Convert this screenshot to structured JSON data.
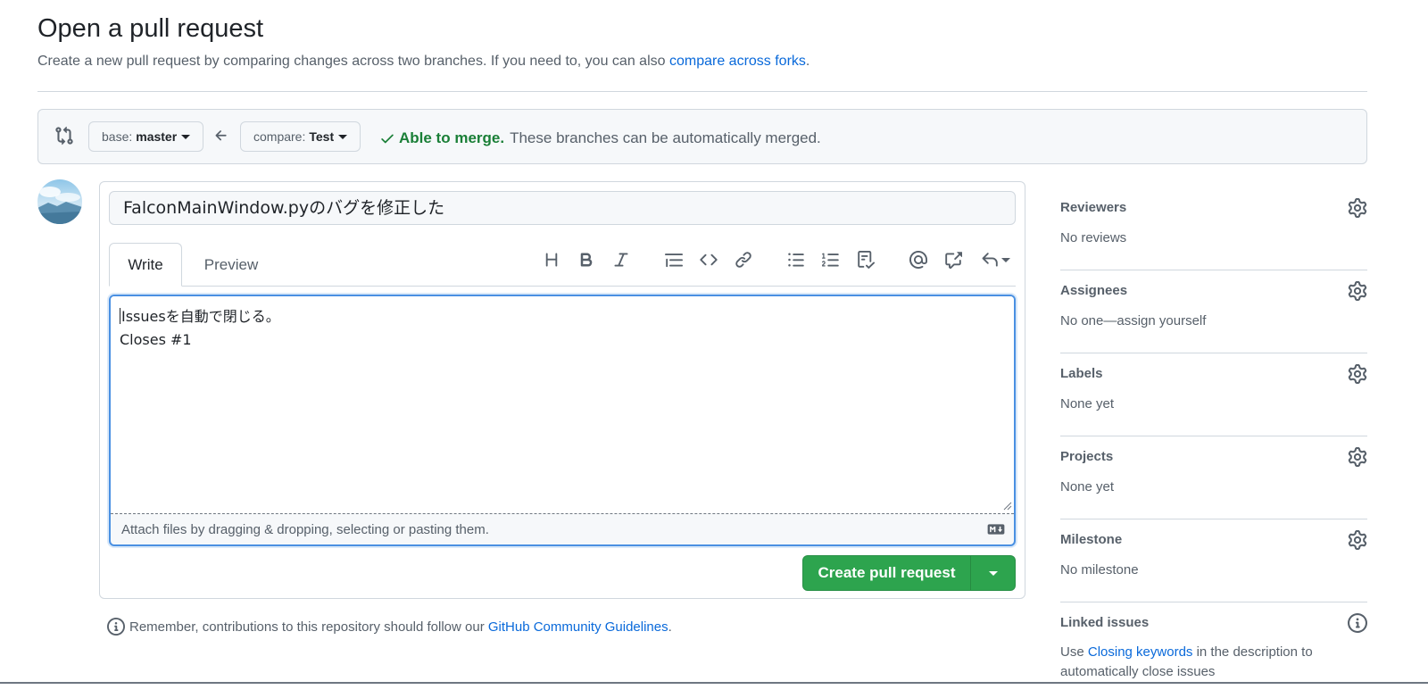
{
  "page": {
    "title": "Open a pull request",
    "subtitle_prefix": "Create a new pull request by comparing changes across two branches. If you need to, you can also",
    "subtitle_link": "compare across forks",
    "subtitle_suffix": "."
  },
  "range": {
    "base_prefix": "base:",
    "base_branch": "master",
    "compare_prefix": "compare:",
    "compare_branch": "Test",
    "merge_ok": "Able to merge.",
    "merge_msg": "These branches can be automatically merged."
  },
  "form": {
    "title_value": "FalconMainWindow.pyのバグを修正した",
    "tabs": {
      "write": "Write",
      "preview": "Preview"
    },
    "body_lines": [
      "Issuesを自動で閉じる。",
      "Closes #1"
    ],
    "attach_hint": "Attach files by dragging & dropping, selecting or pasting them.",
    "submit_label": "Create pull request"
  },
  "toolbar": {
    "icons": [
      "heading-icon",
      "bold-icon",
      "italic-icon",
      "quote-icon",
      "code-icon",
      "link-icon",
      "unordered-list-icon",
      "ordered-list-icon",
      "task-list-icon",
      "mention-icon",
      "cross-reference-icon",
      "reply-icon"
    ]
  },
  "footer": {
    "remember_prefix": "Remember, contributions to this repository should follow our",
    "remember_link": "GitHub Community Guidelines",
    "remember_suffix": "."
  },
  "sidebar": {
    "reviewers": {
      "heading": "Reviewers",
      "value": "No reviews"
    },
    "assignees": {
      "heading": "Assignees",
      "value": "No one—assign yourself"
    },
    "labels": {
      "heading": "Labels",
      "value": "None yet"
    },
    "projects": {
      "heading": "Projects",
      "value": "None yet"
    },
    "milestone": {
      "heading": "Milestone",
      "value": "No milestone"
    },
    "linked_issues": {
      "heading": "Linked issues",
      "value_prefix": "Use",
      "value_link": "Closing keywords",
      "value_suffix": "in the description to automatically close issues"
    }
  },
  "colors": {
    "accent": "#0969da",
    "success": "#2da44e",
    "success_text": "#1a7f37",
    "focus_border": "#4a90e2"
  }
}
